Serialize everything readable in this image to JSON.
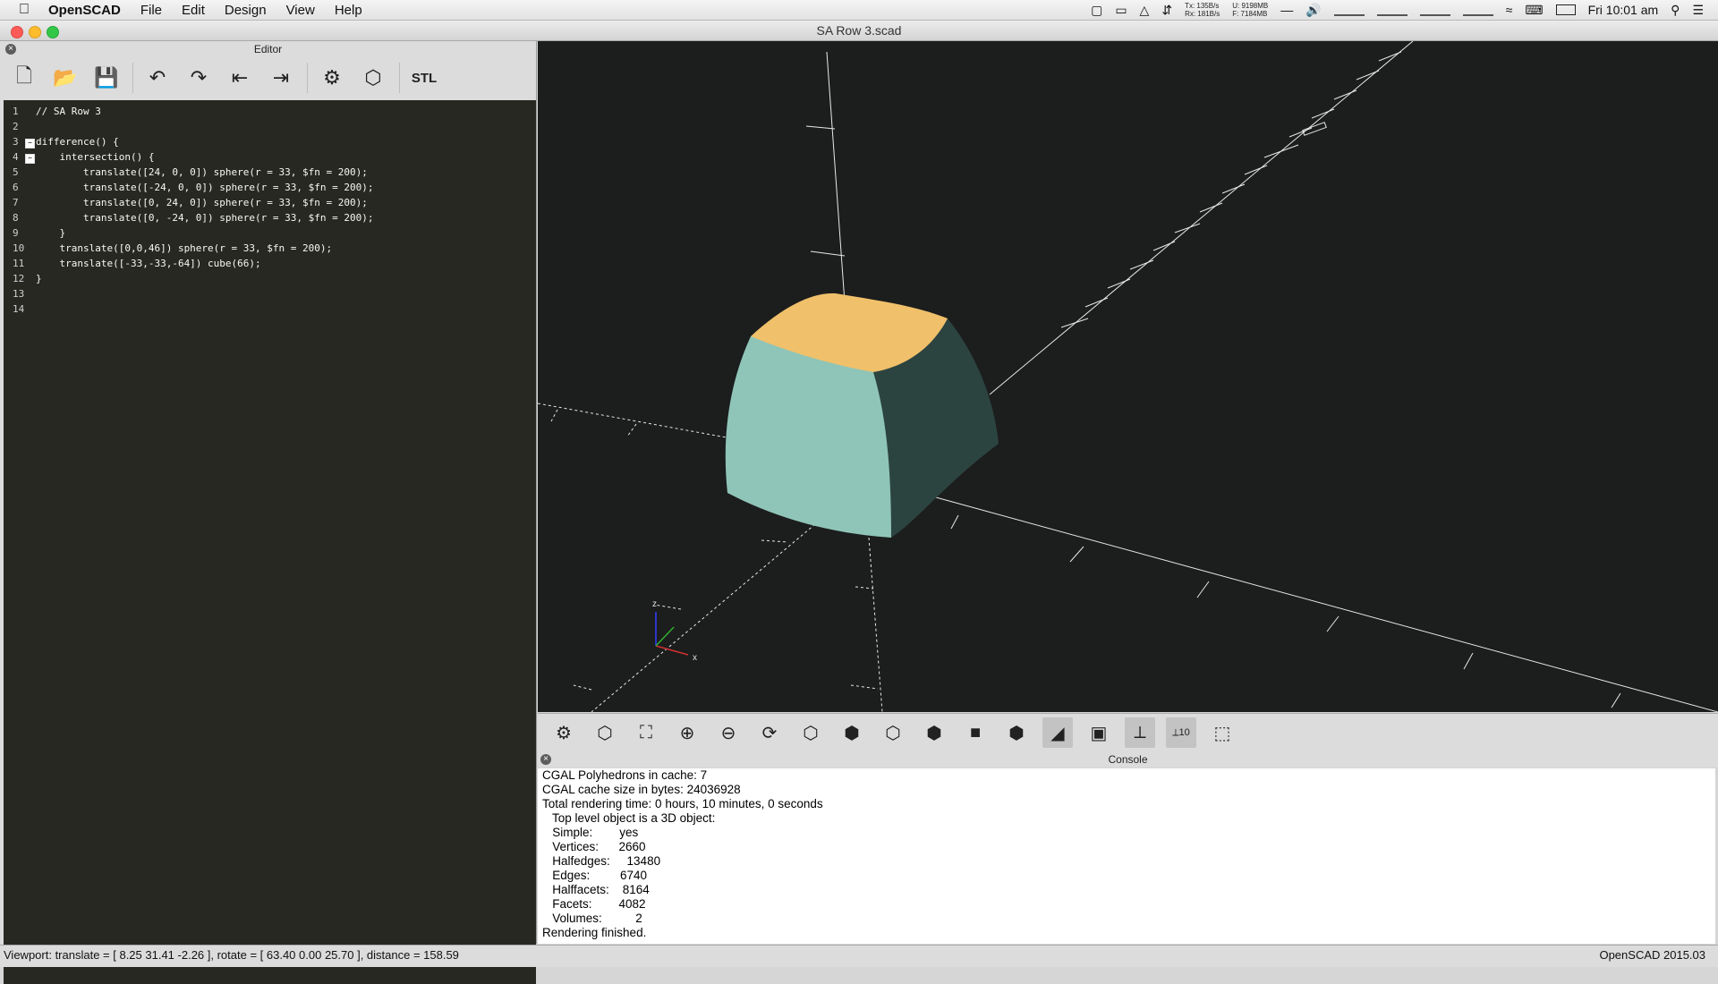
{
  "menubar": {
    "app_name": "OpenSCAD",
    "items": [
      "File",
      "Edit",
      "Design",
      "View",
      "Help"
    ],
    "net_tx": "135B/s",
    "net_rx": "181B/s",
    "mem_u": "9198MB",
    "mem_f": "7184MB",
    "clock": "Fri 10:01 am",
    "tx_label": "Tx:",
    "rx_label": "Rx:",
    "u_label": "U:",
    "f_label": "F:"
  },
  "window": {
    "title": "SA Row 3.scad"
  },
  "editor": {
    "title": "Editor",
    "stl_label": "STL",
    "lines": [
      {
        "n": "1",
        "text": "// SA Row 3"
      },
      {
        "n": "2",
        "text": ""
      },
      {
        "n": "3",
        "text": "difference() {"
      },
      {
        "n": "4",
        "text": "    intersection() {"
      },
      {
        "n": "5",
        "text": "        translate([24, 0, 0]) sphere(r = 33, $fn = 200);"
      },
      {
        "n": "6",
        "text": "        translate([-24, 0, 0]) sphere(r = 33, $fn = 200);"
      },
      {
        "n": "7",
        "text": "        translate([0, 24, 0]) sphere(r = 33, $fn = 200);"
      },
      {
        "n": "8",
        "text": "        translate([0, -24, 0]) sphere(r = 33, $fn = 200);"
      },
      {
        "n": "9",
        "text": "    }"
      },
      {
        "n": "10",
        "text": "    translate([0,0,46]) sphere(r = 33, $fn = 200);"
      },
      {
        "n": "11",
        "text": "    translate([-33,-33,-64]) cube(66);"
      },
      {
        "n": "12",
        "text": "}"
      },
      {
        "n": "13",
        "text": ""
      },
      {
        "n": "14",
        "text": ""
      }
    ]
  },
  "viewport": {
    "axis_z": "z",
    "axis_x": "x",
    "colors": {
      "top_face": "#f0c06b",
      "side_light": "#8fc5b8",
      "side_dark": "#2c4440",
      "background": "#1c1d1d"
    }
  },
  "view_toolbar": {
    "axes_label": "10"
  },
  "console": {
    "title": "Console",
    "lines": [
      "CGAL Polyhedrons in cache: 7",
      "CGAL cache size in bytes: 24036928",
      "Total rendering time: 0 hours, 10 minutes, 0 seconds",
      "   Top level object is a 3D object:",
      "   Simple:        yes",
      "   Vertices:      2660",
      "   Halfedges:     13480",
      "   Edges:         6740",
      "   Halffacets:    8164",
      "   Facets:        4082",
      "   Volumes:          2",
      "Rendering finished."
    ]
  },
  "statusbar": {
    "viewport": "Viewport: translate = [ 8.25 31.41 -2.26 ], rotate = [ 63.40 0.00 25.70 ], distance = 158.59",
    "version": "OpenSCAD 2015.03"
  }
}
